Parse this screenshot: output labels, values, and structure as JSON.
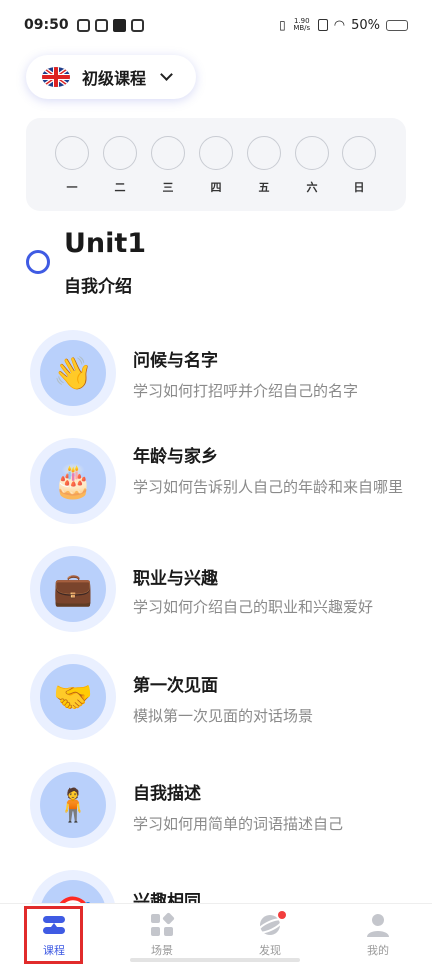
{
  "status_bar": {
    "time": "09:50",
    "net_speed_value": "1.90",
    "net_speed_unit": "MB/s",
    "battery": "50%",
    "battery_level": 0.5
  },
  "course": {
    "title": "初级课程",
    "flag_icon": "uk-flag-icon"
  },
  "week": {
    "days": [
      "一",
      "二",
      "三",
      "四",
      "五",
      "六",
      "日"
    ]
  },
  "unit": {
    "title": "Unit1",
    "subtitle": "自我介绍"
  },
  "lessons": [
    {
      "title": "问候与名字",
      "desc": "学习如何打招呼并介绍自己的名字",
      "icon": "waving-hand-icon",
      "emoji": "👋"
    },
    {
      "title": "年龄与家乡",
      "desc": "学习如何告诉别人自己的年龄和来自哪里",
      "icon": "birthday-cake-icon",
      "emoji": "🎂"
    },
    {
      "title": "职业与兴趣",
      "desc": "学习如何介绍自己的职业和兴趣爱好",
      "icon": "briefcase-icon",
      "emoji": "💼"
    },
    {
      "title": "第一次见面",
      "desc": "模拟第一次见面的对话场景",
      "icon": "handshake-icon",
      "emoji": "🤝"
    },
    {
      "title": "自我描述",
      "desc": "学习如何用简单的词语描述自己",
      "icon": "person-icon",
      "emoji": "🧍"
    },
    {
      "title": "兴趣相同",
      "desc": "",
      "icon": "target-icon",
      "emoji": "🎯"
    }
  ],
  "nav": {
    "items": [
      {
        "label": "课程",
        "icon": "course-icon",
        "active": true
      },
      {
        "label": "场景",
        "icon": "scene-grid-icon",
        "active": false
      },
      {
        "label": "发现",
        "icon": "planet-icon",
        "active": false
      },
      {
        "label": "我的",
        "icon": "profile-icon",
        "active": false
      }
    ]
  },
  "colors": {
    "accent": "#3f5be3",
    "badge": "#f23e3e",
    "highlight_box": "#e12b2b"
  }
}
